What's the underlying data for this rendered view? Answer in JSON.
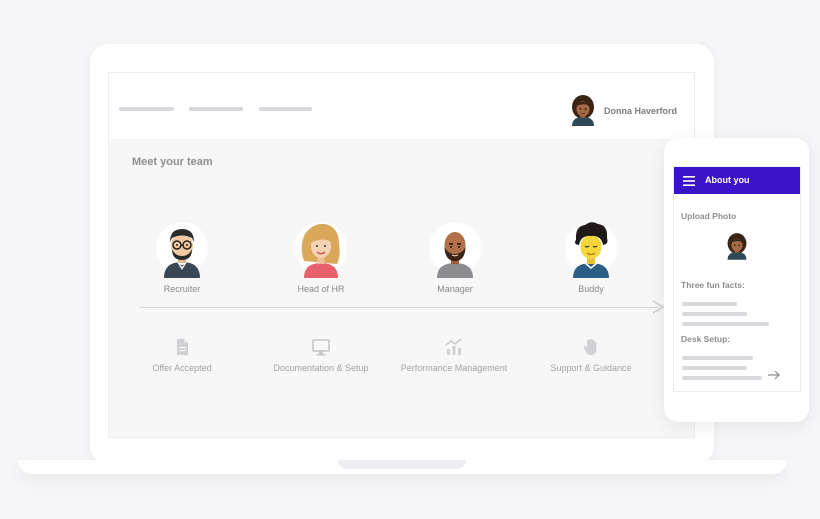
{
  "laptop": {
    "header": {
      "user_name": "Donna Haverford"
    },
    "section_title": "Meet your team",
    "team": [
      {
        "role": "Recruiter",
        "avatar": "recruiter-avatar"
      },
      {
        "role": "Head of HR",
        "avatar": "head-of-hr-avatar"
      },
      {
        "role": "Manager",
        "avatar": "manager-avatar"
      },
      {
        "role": "Buddy",
        "avatar": "buddy-avatar"
      }
    ],
    "steps": [
      {
        "label": "Offer Accepted",
        "icon": "document-icon"
      },
      {
        "label": "Documentation & Setup",
        "icon": "monitor-icon"
      },
      {
        "label": "Performance Management",
        "icon": "chart-icon"
      },
      {
        "label": "Support & Guidance",
        "icon": "hand-icon"
      }
    ]
  },
  "phone": {
    "title": "About you",
    "upload_label": "Upload Photo",
    "facts_label": "Three fun facts:",
    "desk_label": "Desk Setup:"
  },
  "colors": {
    "accent": "#3a14c9",
    "background": "#f6f6f8",
    "muted_text": "#8a8a8f"
  }
}
